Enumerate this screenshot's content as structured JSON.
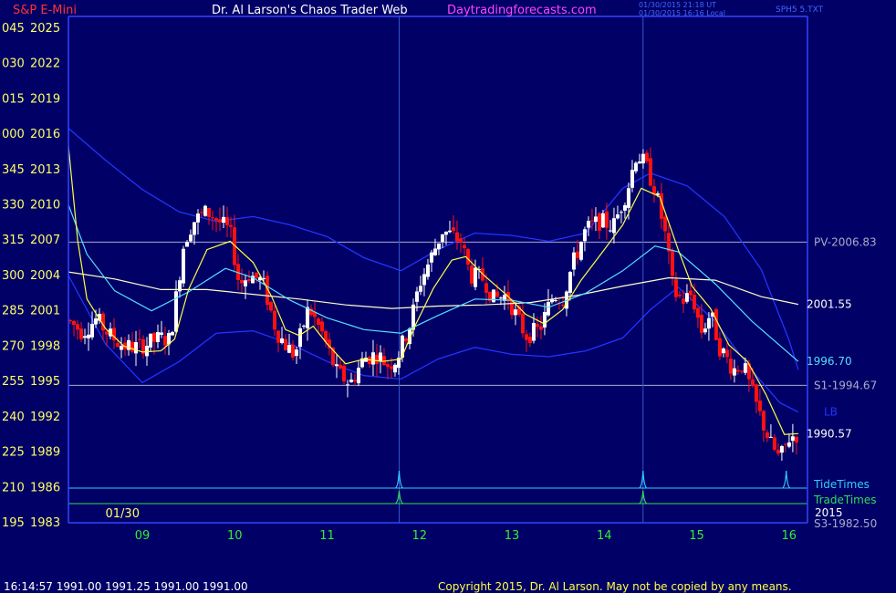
{
  "header": {
    "symbol": "S&P E-Mini",
    "author": "Dr. Al Larson's Chaos Trader Web",
    "site": "Daytradingforecasts.com",
    "stamp_utc": "01/30/2015 21:18 UT",
    "stamp_local": "01/30/2015 16:16 Local",
    "corner": "SPH5 5.TXT"
  },
  "footer": {
    "quote": "16:14:57  1991.00  1991.25  1991.00  1991.00",
    "copyright": "Copyright 2015, Dr. Al Larson. May not be copied by any means."
  },
  "colors": {
    "background": "#000066",
    "frame": "#3344ff",
    "axis_text": "#ffff66",
    "up_bar": "#ffffff",
    "down_bar": "#ff1111",
    "fast_ma": "#ffff44",
    "slow_ma": "#ffffcc",
    "mid_ma": "#55ddff",
    "band": "#2233ff",
    "level_line": "#aaaacc",
    "tide": "#33ccff",
    "trade": "#33dd55",
    "hour_label": "#33ee33"
  },
  "chart_data": {
    "type": "candlestick",
    "date_label": "01/30",
    "year_label": "2015",
    "x_ticks": [
      "09",
      "10",
      "11",
      "12",
      "13",
      "14",
      "15",
      "16"
    ],
    "x_tick_hours": [
      9,
      10,
      11,
      12,
      13,
      14,
      15,
      16
    ],
    "x_range": [
      8.2,
      16.2
    ],
    "y_range": [
      1983,
      2026
    ],
    "y_ticks": [
      {
        "angle": "045",
        "price": "2025",
        "value": 2025
      },
      {
        "angle": "030",
        "price": "2022",
        "value": 2022
      },
      {
        "angle": "015",
        "price": "2019",
        "value": 2019
      },
      {
        "angle": "000",
        "price": "2016",
        "value": 2016
      },
      {
        "angle": "345",
        "price": "2013",
        "value": 2013
      },
      {
        "angle": "330",
        "price": "2010",
        "value": 2010
      },
      {
        "angle": "315",
        "price": "2007",
        "value": 2007
      },
      {
        "angle": "300",
        "price": "2004",
        "value": 2004
      },
      {
        "angle": "285",
        "price": "2001",
        "value": 2001
      },
      {
        "angle": "270",
        "price": "1998",
        "value": 1998
      },
      {
        "angle": "255",
        "price": "1995",
        "value": 1995
      },
      {
        "angle": "240",
        "price": "1992",
        "value": 1992
      },
      {
        "angle": "225",
        "price": "1989",
        "value": 1989
      },
      {
        "angle": "210",
        "price": "1986",
        "value": 1986
      },
      {
        "angle": "195",
        "price": "1983",
        "value": 1983
      }
    ],
    "levels": [
      {
        "label": "PV-2006.83",
        "value": 2006.83
      },
      {
        "label": "S1-1994.67",
        "value": 1994.67
      },
      {
        "label": "S3-1982.50",
        "value": 1982.5
      }
    ],
    "right_labels": [
      {
        "label": "2001.55",
        "value": 2001.55,
        "series": "slow_ma"
      },
      {
        "label": "1996.70",
        "value": 1996.7,
        "series": "mid_ma"
      },
      {
        "label": "1990.57",
        "value": 1990.57,
        "series": "fast_ma"
      },
      {
        "label": "LB",
        "value": 1992.4,
        "series": "band"
      }
    ],
    "legend": [
      {
        "label": "TideTimes",
        "series": "tide"
      },
      {
        "label": "TradeTimes",
        "series": "trade"
      }
    ],
    "event_times": [
      11.78,
      14.42,
      15.97
    ],
    "trade_times": [
      11.78,
      14.42
    ],
    "close_path": [
      {
        "t": 8.2,
        "v": 2000.2
      },
      {
        "t": 8.35,
        "v": 1999.2
      },
      {
        "t": 8.5,
        "v": 2000.3
      },
      {
        "t": 8.65,
        "v": 1998.9
      },
      {
        "t": 8.8,
        "v": 1998.0
      },
      {
        "t": 8.95,
        "v": 1997.9
      },
      {
        "t": 9.05,
        "v": 1998.2
      },
      {
        "t": 9.2,
        "v": 1998.7
      },
      {
        "t": 9.3,
        "v": 1998.5
      },
      {
        "t": 9.45,
        "v": 2006.8
      },
      {
        "t": 9.55,
        "v": 2008.6
      },
      {
        "t": 9.7,
        "v": 2009.4
      },
      {
        "t": 9.8,
        "v": 2008.8
      },
      {
        "t": 9.95,
        "v": 2007.7
      },
      {
        "t": 10.05,
        "v": 2003.2
      },
      {
        "t": 10.15,
        "v": 2004.1
      },
      {
        "t": 10.3,
        "v": 2003.5
      },
      {
        "t": 10.45,
        "v": 1999.3
      },
      {
        "t": 10.55,
        "v": 1998.1
      },
      {
        "t": 10.65,
        "v": 1997.2
      },
      {
        "t": 10.8,
        "v": 2001.3
      },
      {
        "t": 10.95,
        "v": 1999.0
      },
      {
        "t": 11.1,
        "v": 1995.8
      },
      {
        "t": 11.25,
        "v": 1994.8
      },
      {
        "t": 11.4,
        "v": 1997.0
      },
      {
        "t": 11.55,
        "v": 1997.3
      },
      {
        "t": 11.65,
        "v": 1996.4
      },
      {
        "t": 11.75,
        "v": 1996.9
      },
      {
        "t": 11.9,
        "v": 1999.9
      },
      {
        "t": 12.0,
        "v": 2003.3
      },
      {
        "t": 12.15,
        "v": 2006.0
      },
      {
        "t": 12.25,
        "v": 2007.8
      },
      {
        "t": 12.35,
        "v": 2007.4
      },
      {
        "t": 12.45,
        "v": 2006.9
      },
      {
        "t": 12.55,
        "v": 2004.0
      },
      {
        "t": 12.7,
        "v": 2003.7
      },
      {
        "t": 12.8,
        "v": 2002.0
      },
      {
        "t": 12.95,
        "v": 2002.3
      },
      {
        "t": 13.05,
        "v": 2000.5
      },
      {
        "t": 13.15,
        "v": 1998.9
      },
      {
        "t": 13.3,
        "v": 1999.4
      },
      {
        "t": 13.45,
        "v": 2002.4
      },
      {
        "t": 13.55,
        "v": 2002.0
      },
      {
        "t": 13.65,
        "v": 2004.8
      },
      {
        "t": 13.8,
        "v": 2007.9
      },
      {
        "t": 13.95,
        "v": 2008.6
      },
      {
        "t": 14.1,
        "v": 2008.2
      },
      {
        "t": 14.25,
        "v": 2011.3
      },
      {
        "t": 14.35,
        "v": 2014.4
      },
      {
        "t": 14.45,
        "v": 2013.3
      },
      {
        "t": 14.55,
        "v": 2011.3
      },
      {
        "t": 14.65,
        "v": 2007.9
      },
      {
        "t": 14.75,
        "v": 2002.6
      },
      {
        "t": 14.85,
        "v": 2001.9
      },
      {
        "t": 14.95,
        "v": 2002.4
      },
      {
        "t": 15.05,
        "v": 1999.2
      },
      {
        "t": 15.15,
        "v": 2000.8
      },
      {
        "t": 15.25,
        "v": 1997.9
      },
      {
        "t": 15.4,
        "v": 1996.0
      },
      {
        "t": 15.5,
        "v": 1996.5
      },
      {
        "t": 15.6,
        "v": 1994.0
      },
      {
        "t": 15.7,
        "v": 1991.8
      },
      {
        "t": 15.8,
        "v": 1989.7
      },
      {
        "t": 15.9,
        "v": 1988.4
      },
      {
        "t": 16.0,
        "v": 1990.2
      },
      {
        "t": 16.1,
        "v": 1990.57
      }
    ],
    "fast_ma": [
      {
        "t": 8.2,
        "v": 2015.0
      },
      {
        "t": 8.3,
        "v": 2007.0
      },
      {
        "t": 8.4,
        "v": 2002.0
      },
      {
        "t": 8.6,
        "v": 1999.5
      },
      {
        "t": 8.8,
        "v": 1998.0
      },
      {
        "t": 9.0,
        "v": 1997.5
      },
      {
        "t": 9.2,
        "v": 1997.6
      },
      {
        "t": 9.35,
        "v": 1998.6
      },
      {
        "t": 9.5,
        "v": 2002.8
      },
      {
        "t": 9.7,
        "v": 2006.2
      },
      {
        "t": 9.95,
        "v": 2006.9
      },
      {
        "t": 10.2,
        "v": 2005.1
      },
      {
        "t": 10.4,
        "v": 2002.2
      },
      {
        "t": 10.55,
        "v": 1999.4
      },
      {
        "t": 10.7,
        "v": 1998.9
      },
      {
        "t": 10.85,
        "v": 1999.7
      },
      {
        "t": 11.0,
        "v": 1998.2
      },
      {
        "t": 11.2,
        "v": 1996.5
      },
      {
        "t": 11.4,
        "v": 1996.9
      },
      {
        "t": 11.6,
        "v": 1996.7
      },
      {
        "t": 11.8,
        "v": 1996.9
      },
      {
        "t": 11.95,
        "v": 1999.7
      },
      {
        "t": 12.15,
        "v": 2002.9
      },
      {
        "t": 12.35,
        "v": 2005.3
      },
      {
        "t": 12.5,
        "v": 2005.6
      },
      {
        "t": 12.7,
        "v": 2004.0
      },
      {
        "t": 12.95,
        "v": 2002.3
      },
      {
        "t": 13.15,
        "v": 2000.7
      },
      {
        "t": 13.35,
        "v": 1999.9
      },
      {
        "t": 13.55,
        "v": 2001.1
      },
      {
        "t": 13.75,
        "v": 2003.6
      },
      {
        "t": 14.0,
        "v": 2006.2
      },
      {
        "t": 14.2,
        "v": 2008.3
      },
      {
        "t": 14.4,
        "v": 2011.4
      },
      {
        "t": 14.6,
        "v": 2010.7
      },
      {
        "t": 14.8,
        "v": 2006.2
      },
      {
        "t": 14.95,
        "v": 2003.1
      },
      {
        "t": 15.15,
        "v": 2001.2
      },
      {
        "t": 15.35,
        "v": 1998.1
      },
      {
        "t": 15.55,
        "v": 1996.7
      },
      {
        "t": 15.75,
        "v": 1993.9
      },
      {
        "t": 15.95,
        "v": 1990.5
      },
      {
        "t": 16.1,
        "v": 1990.57
      }
    ],
    "slow_ma": [
      {
        "t": 8.2,
        "v": 2004.3
      },
      {
        "t": 8.7,
        "v": 2003.7
      },
      {
        "t": 9.2,
        "v": 2002.8
      },
      {
        "t": 9.7,
        "v": 2002.8
      },
      {
        "t": 10.2,
        "v": 2002.4
      },
      {
        "t": 10.7,
        "v": 2002.0
      },
      {
        "t": 11.2,
        "v": 2001.5
      },
      {
        "t": 11.7,
        "v": 2001.2
      },
      {
        "t": 12.2,
        "v": 2001.4
      },
      {
        "t": 12.7,
        "v": 2001.5
      },
      {
        "t": 13.2,
        "v": 2001.7
      },
      {
        "t": 13.7,
        "v": 2002.3
      },
      {
        "t": 14.2,
        "v": 2003.1
      },
      {
        "t": 14.7,
        "v": 2003.8
      },
      {
        "t": 15.2,
        "v": 2003.6
      },
      {
        "t": 15.7,
        "v": 2002.2
      },
      {
        "t": 16.1,
        "v": 2001.55
      }
    ],
    "mid_ma": [
      {
        "t": 8.2,
        "v": 2010.0
      },
      {
        "t": 8.4,
        "v": 2005.8
      },
      {
        "t": 8.7,
        "v": 2002.7
      },
      {
        "t": 9.1,
        "v": 2001.0
      },
      {
        "t": 9.5,
        "v": 2002.6
      },
      {
        "t": 9.9,
        "v": 2004.6
      },
      {
        "t": 10.2,
        "v": 2003.8
      },
      {
        "t": 10.6,
        "v": 2001.9
      },
      {
        "t": 11.0,
        "v": 2000.4
      },
      {
        "t": 11.4,
        "v": 1999.4
      },
      {
        "t": 11.8,
        "v": 1999.1
      },
      {
        "t": 12.2,
        "v": 2000.6
      },
      {
        "t": 12.6,
        "v": 2002.0
      },
      {
        "t": 13.0,
        "v": 2001.9
      },
      {
        "t": 13.4,
        "v": 2001.3
      },
      {
        "t": 13.8,
        "v": 2002.5
      },
      {
        "t": 14.2,
        "v": 2004.4
      },
      {
        "t": 14.55,
        "v": 2006.5
      },
      {
        "t": 14.8,
        "v": 2006.0
      },
      {
        "t": 15.2,
        "v": 2003.3
      },
      {
        "t": 15.6,
        "v": 2000.1
      },
      {
        "t": 16.1,
        "v": 1996.7
      }
    ],
    "upper_band": [
      {
        "t": 8.2,
        "v": 2016.5
      },
      {
        "t": 8.6,
        "v": 2013.8
      },
      {
        "t": 9.0,
        "v": 2011.3
      },
      {
        "t": 9.4,
        "v": 2009.4
      },
      {
        "t": 9.8,
        "v": 2008.6
      },
      {
        "t": 10.2,
        "v": 2009.0
      },
      {
        "t": 10.6,
        "v": 2008.3
      },
      {
        "t": 11.0,
        "v": 2007.3
      },
      {
        "t": 11.4,
        "v": 2005.5
      },
      {
        "t": 11.8,
        "v": 2004.4
      },
      {
        "t": 12.2,
        "v": 2006.2
      },
      {
        "t": 12.6,
        "v": 2007.6
      },
      {
        "t": 13.0,
        "v": 2007.4
      },
      {
        "t": 13.4,
        "v": 2006.9
      },
      {
        "t": 13.8,
        "v": 2007.6
      },
      {
        "t": 14.2,
        "v": 2011.4
      },
      {
        "t": 14.5,
        "v": 2012.7
      },
      {
        "t": 14.9,
        "v": 2011.6
      },
      {
        "t": 15.3,
        "v": 2009.0
      },
      {
        "t": 15.7,
        "v": 2004.5
      },
      {
        "t": 16.0,
        "v": 1998.5
      },
      {
        "t": 16.1,
        "v": 1996.0
      }
    ],
    "lower_band": [
      {
        "t": 8.2,
        "v": 2004.0
      },
      {
        "t": 8.6,
        "v": 1998.2
      },
      {
        "t": 9.0,
        "v": 1994.9
      },
      {
        "t": 9.4,
        "v": 1996.7
      },
      {
        "t": 9.8,
        "v": 1999.1
      },
      {
        "t": 10.2,
        "v": 1999.3
      },
      {
        "t": 10.6,
        "v": 1998.2
      },
      {
        "t": 11.0,
        "v": 1996.7
      },
      {
        "t": 11.4,
        "v": 1995.5
      },
      {
        "t": 11.8,
        "v": 1995.2
      },
      {
        "t": 12.2,
        "v": 1996.9
      },
      {
        "t": 12.6,
        "v": 1997.9
      },
      {
        "t": 13.0,
        "v": 1997.3
      },
      {
        "t": 13.4,
        "v": 1997.1
      },
      {
        "t": 13.8,
        "v": 1997.6
      },
      {
        "t": 14.2,
        "v": 1998.7
      },
      {
        "t": 14.5,
        "v": 2001.1
      },
      {
        "t": 14.8,
        "v": 2003.0
      },
      {
        "t": 15.2,
        "v": 2000.1
      },
      {
        "t": 15.6,
        "v": 1995.9
      },
      {
        "t": 15.9,
        "v": 1993.2
      },
      {
        "t": 16.1,
        "v": 1992.4
      }
    ]
  }
}
